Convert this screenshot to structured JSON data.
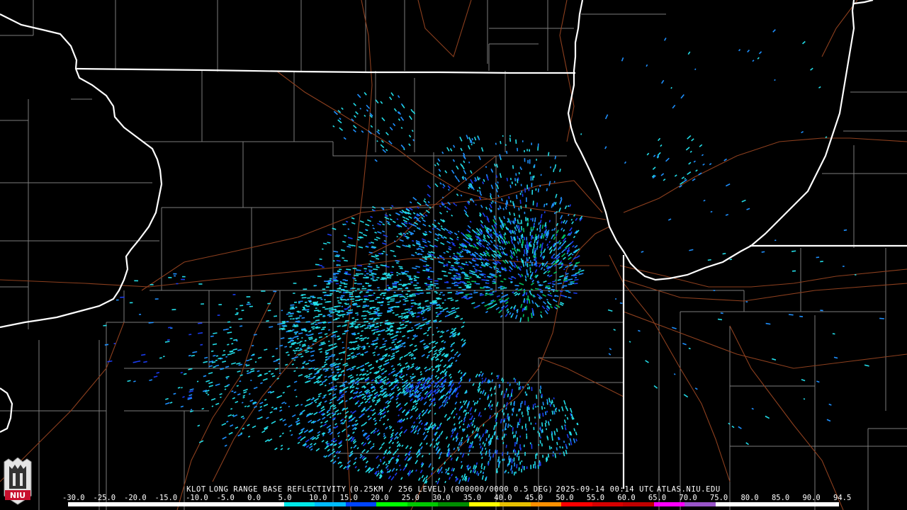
{
  "product": {
    "site": "KLOT",
    "title": "LONG RANGE BASE REFLECTIVITY",
    "resolution": "(0.25KM / 256 LEVEL)",
    "codes": "(000000/0000 0.5 DEG)",
    "timestamp": "2025-09-14 00:14 UTC",
    "source": "ATLAS.NIU.EDU"
  },
  "colorscale": {
    "labels": [
      "-30.0",
      "-25.0",
      "-20.0",
      "-15.0",
      "-10.0",
      "-5.0",
      "0.0",
      "5.0",
      "10.0",
      "15.0",
      "20.0",
      "25.0",
      "30.0",
      "35.0",
      "40.0",
      "45.0",
      "50.0",
      "55.0",
      "60.0",
      "65.0",
      "70.0",
      "75.0",
      "80.0",
      "85.0",
      "90.0",
      "94.5"
    ],
    "colors": [
      "#ffffff",
      "#ffffff",
      "#ffffff",
      "#ffffff",
      "#ffffff",
      "#ffffff",
      "#ffffff",
      "#00e8e8",
      "#00bbff",
      "#0044ff",
      "#00ff00",
      "#00c800",
      "#008c00",
      "#ffff00",
      "#e7c000",
      "#ff9000",
      "#ff0000",
      "#d60000",
      "#c00000",
      "#ff00ff",
      "#9955c9",
      "#ffffff",
      "#ffffff",
      "#ffffff",
      "#ffffff"
    ]
  },
  "logo": {
    "text": "NIU",
    "bg": "#c8102e"
  },
  "colors": {
    "state_border": "#ffffff",
    "county_border": "#8a8a8a",
    "road": "#9a4a22",
    "echo_light": "#22dde8",
    "echo_mid": "#1e90ff",
    "echo_dark": "#1a3cf0"
  }
}
